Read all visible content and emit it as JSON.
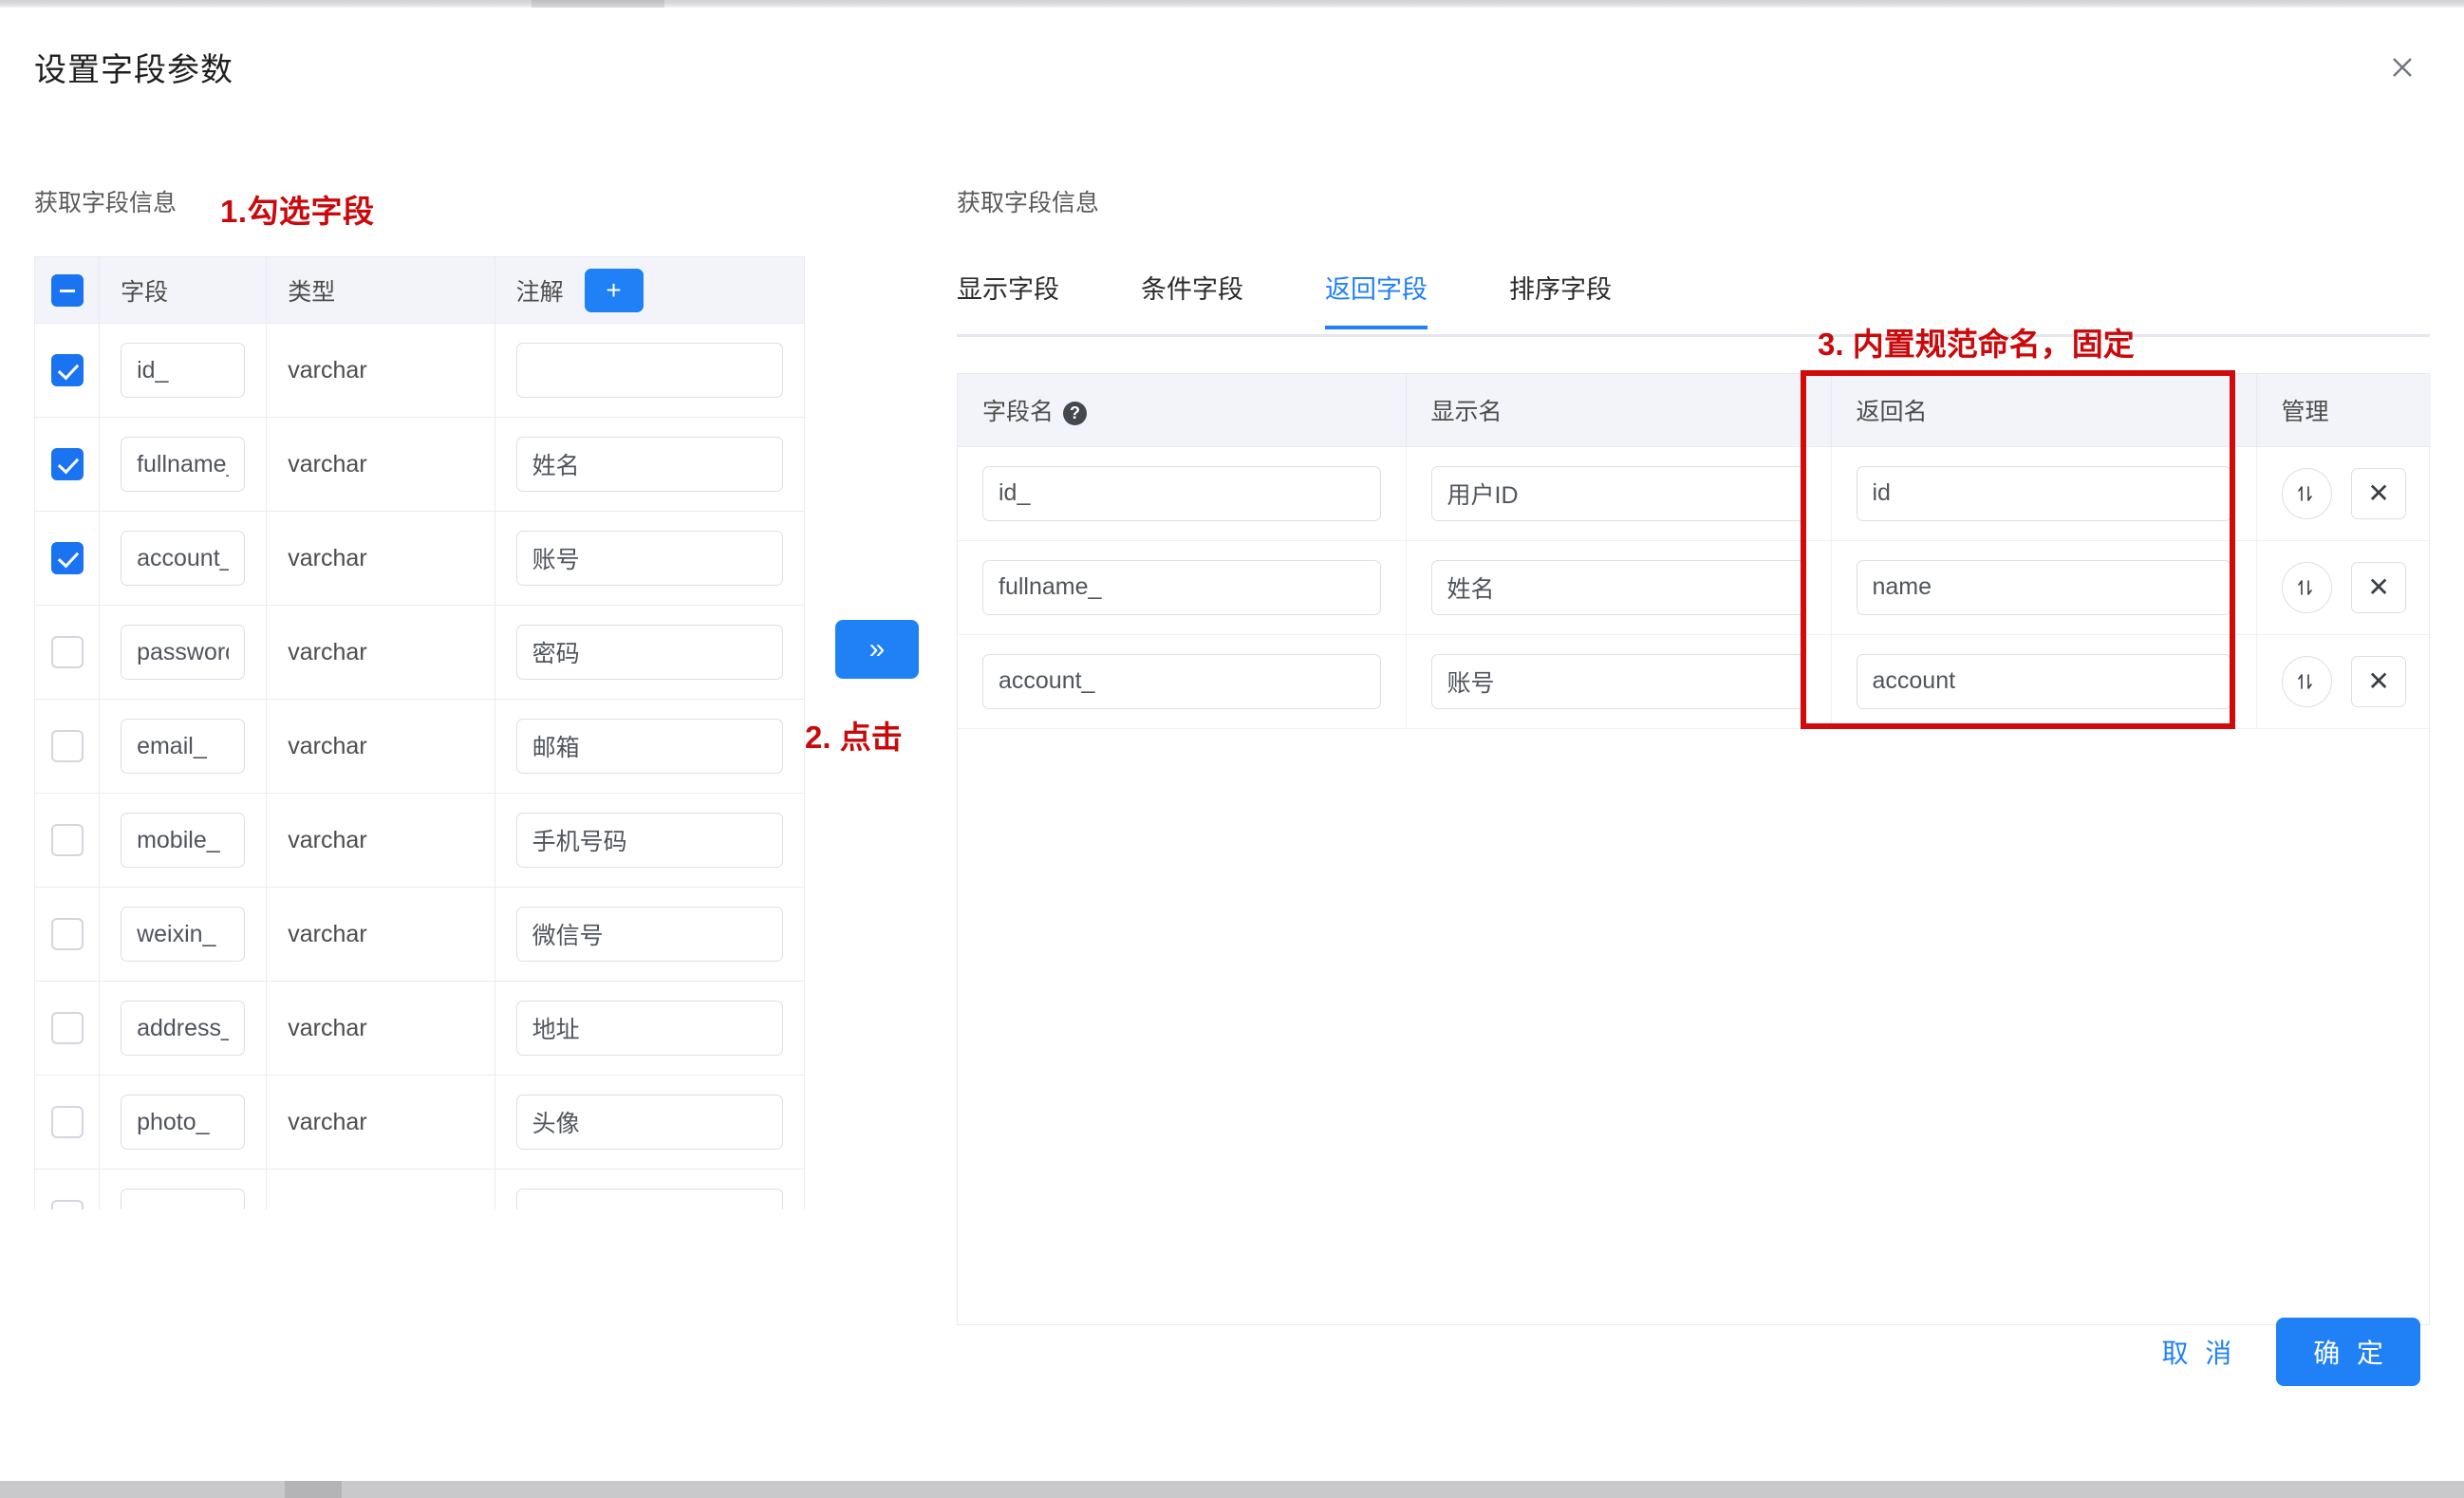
{
  "dialog": {
    "title": "设置字段参数",
    "close_icon": "close-icon"
  },
  "left": {
    "section_label": "获取字段信息",
    "annotation": "1.勾选字段",
    "headers": {
      "checkbox": "",
      "field": "字段",
      "type": "类型",
      "note": "注解",
      "add_label": "+"
    },
    "rows": [
      {
        "checked": true,
        "field": "id_",
        "type": "varchar",
        "note": ""
      },
      {
        "checked": true,
        "field": "fullname_",
        "type": "varchar",
        "note": "姓名"
      },
      {
        "checked": true,
        "field": "account_",
        "type": "varchar",
        "note": "账号"
      },
      {
        "checked": false,
        "field": "password_",
        "type": "varchar",
        "note": "密码"
      },
      {
        "checked": false,
        "field": "email_",
        "type": "varchar",
        "note": "邮箱"
      },
      {
        "checked": false,
        "field": "mobile_",
        "type": "varchar",
        "note": "手机号码"
      },
      {
        "checked": false,
        "field": "weixin_",
        "type": "varchar",
        "note": "微信号"
      },
      {
        "checked": false,
        "field": "address_",
        "type": "varchar",
        "note": "地址"
      },
      {
        "checked": false,
        "field": "photo_",
        "type": "varchar",
        "note": "头像"
      },
      {
        "checked": false,
        "field": "",
        "type": "",
        "note": ""
      }
    ]
  },
  "transfer": {
    "label": "»",
    "annotation": "2. 点击"
  },
  "right": {
    "section_label": "获取字段信息",
    "annotation": "3. 内置规范命名，固定",
    "tabs": [
      {
        "label": "显示字段",
        "active": false
      },
      {
        "label": "条件字段",
        "active": false
      },
      {
        "label": "返回字段",
        "active": true
      },
      {
        "label": "排序字段",
        "active": false
      }
    ],
    "headers": {
      "field_name": "字段名",
      "help_icon": "help-icon",
      "display_name": "显示名",
      "return_name": "返回名",
      "manage": "管理"
    },
    "rows": [
      {
        "field_name": "id_",
        "display_name": "用户ID",
        "return_name": "id",
        "sort_icon": "sort-updown-icon",
        "delete_icon": "✕"
      },
      {
        "field_name": "fullname_",
        "display_name": "姓名",
        "return_name": "name",
        "sort_icon": "sort-updown-icon",
        "delete_icon": "✕"
      },
      {
        "field_name": "account_",
        "display_name": "账号",
        "return_name": "account",
        "sort_icon": "sort-updown-icon",
        "delete_icon": "✕"
      }
    ]
  },
  "footer": {
    "cancel": "取 消",
    "confirm": "确 定"
  },
  "colors": {
    "primary": "#2080f6",
    "annotation_red": "#c9090b",
    "highlight_red": "#d10a0a",
    "header_bg": "#f2f4f9",
    "border": "#e8eaf2"
  }
}
